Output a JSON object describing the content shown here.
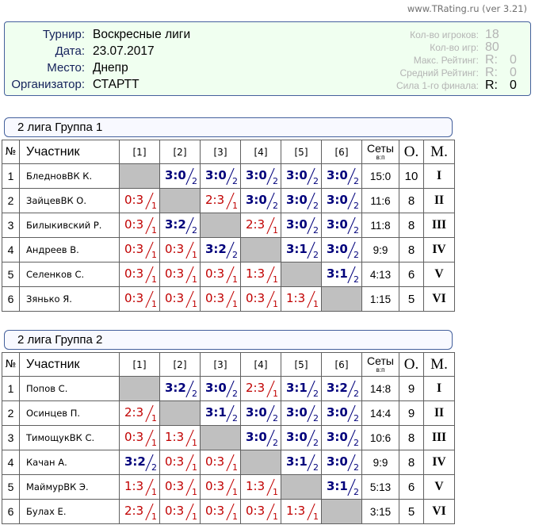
{
  "site": {
    "caption": "www.TRating.ru (ver 3.21)"
  },
  "colors": {
    "win": "#00007b",
    "loss": "#c00000",
    "self_cell": "#c0c0c0",
    "info_bg": "#f0fff0",
    "stat_text": "#b4b4b4",
    "stat_highlight": "#000000"
  },
  "info": {
    "fields": [
      {
        "label": "Турнир:",
        "value": "Воскресные лиги"
      },
      {
        "label": "Дата:",
        "value": "23.07.2017"
      },
      {
        "label": "Место:",
        "value": "Днепр"
      },
      {
        "label": "Организатор:",
        "value": "СТАРТТ"
      }
    ],
    "stats": [
      {
        "label": "Кол-во игроков:",
        "value": "18"
      },
      {
        "label": "Кол-во игр:",
        "value": "80"
      },
      {
        "label": "Макс. Рейтинг:",
        "prefix": "R:",
        "value": "0"
      },
      {
        "label": "Средний Рейтинг:",
        "prefix": "R:",
        "value": "0"
      },
      {
        "label": "Сила 1-го финала:",
        "prefix": "R:",
        "value": "0"
      }
    ]
  },
  "columns": {
    "num": "№",
    "name": "Участник",
    "opponents": [
      "[1]",
      "[2]",
      "[3]",
      "[4]",
      "[5]",
      "[6]"
    ],
    "sets": "Сеты",
    "sets_sub": "в:п",
    "points": "О.",
    "place": "М."
  },
  "groups": [
    {
      "title": "2 лига Группа 1",
      "rows": [
        {
          "num": "1",
          "name": "БледновВК К.",
          "cells": [
            null,
            {
              "score": "3:0",
              "pts": "2"
            },
            {
              "score": "3:0",
              "pts": "2"
            },
            {
              "score": "3:0",
              "pts": "2"
            },
            {
              "score": "3:0",
              "pts": "2"
            },
            {
              "score": "3:0",
              "pts": "2"
            }
          ],
          "sets": "15:0",
          "points": "10",
          "place": "I"
        },
        {
          "num": "2",
          "name": "ЗайцевВК О.",
          "cells": [
            {
              "score": "0:3",
              "pts": "1"
            },
            null,
            {
              "score": "2:3",
              "pts": "1"
            },
            {
              "score": "3:0",
              "pts": "2"
            },
            {
              "score": "3:0",
              "pts": "2"
            },
            {
              "score": "3:0",
              "pts": "2"
            }
          ],
          "sets": "11:6",
          "points": "8",
          "place": "II"
        },
        {
          "num": "3",
          "name": "Билыкивский Р.",
          "cells": [
            {
              "score": "0:3",
              "pts": "1"
            },
            {
              "score": "3:2",
              "pts": "2"
            },
            null,
            {
              "score": "2:3",
              "pts": "1"
            },
            {
              "score": "3:0",
              "pts": "2"
            },
            {
              "score": "3:0",
              "pts": "2"
            }
          ],
          "sets": "11:8",
          "points": "8",
          "place": "III"
        },
        {
          "num": "4",
          "name": "Андреев В.",
          "cells": [
            {
              "score": "0:3",
              "pts": "1"
            },
            {
              "score": "0:3",
              "pts": "1"
            },
            {
              "score": "3:2",
              "pts": "2"
            },
            null,
            {
              "score": "3:1",
              "pts": "2"
            },
            {
              "score": "3:0",
              "pts": "2"
            }
          ],
          "sets": "9:9",
          "points": "8",
          "place": "IV"
        },
        {
          "num": "5",
          "name": "Селенков С.",
          "cells": [
            {
              "score": "0:3",
              "pts": "1"
            },
            {
              "score": "0:3",
              "pts": "1"
            },
            {
              "score": "0:3",
              "pts": "1"
            },
            {
              "score": "1:3",
              "pts": "1"
            },
            null,
            {
              "score": "3:1",
              "pts": "2"
            }
          ],
          "sets": "4:13",
          "points": "6",
          "place": "V"
        },
        {
          "num": "6",
          "name": "Зянько Я.",
          "cells": [
            {
              "score": "0:3",
              "pts": "1"
            },
            {
              "score": "0:3",
              "pts": "1"
            },
            {
              "score": "0:3",
              "pts": "1"
            },
            {
              "score": "0:3",
              "pts": "1"
            },
            {
              "score": "1:3",
              "pts": "1"
            },
            null
          ],
          "sets": "1:15",
          "points": "5",
          "place": "VI"
        }
      ]
    },
    {
      "title": "2 лига Группа 2",
      "rows": [
        {
          "num": "1",
          "name": "Попов С.",
          "cells": [
            null,
            {
              "score": "3:2",
              "pts": "2"
            },
            {
              "score": "3:0",
              "pts": "2"
            },
            {
              "score": "2:3",
              "pts": "1"
            },
            {
              "score": "3:1",
              "pts": "2"
            },
            {
              "score": "3:2",
              "pts": "2"
            }
          ],
          "sets": "14:8",
          "points": "9",
          "place": "I"
        },
        {
          "num": "2",
          "name": "Осинцев П.",
          "cells": [
            {
              "score": "2:3",
              "pts": "1"
            },
            null,
            {
              "score": "3:1",
              "pts": "2"
            },
            {
              "score": "3:0",
              "pts": "2"
            },
            {
              "score": "3:0",
              "pts": "2"
            },
            {
              "score": "3:0",
              "pts": "2"
            }
          ],
          "sets": "14:4",
          "points": "9",
          "place": "II"
        },
        {
          "num": "3",
          "name": "ТимощукВК С.",
          "cells": [
            {
              "score": "0:3",
              "pts": "1"
            },
            {
              "score": "1:3",
              "pts": "1"
            },
            null,
            {
              "score": "3:0",
              "pts": "2"
            },
            {
              "score": "3:0",
              "pts": "2"
            },
            {
              "score": "3:0",
              "pts": "2"
            }
          ],
          "sets": "10:6",
          "points": "8",
          "place": "III"
        },
        {
          "num": "4",
          "name": "Качан А.",
          "cells": [
            {
              "score": "3:2",
              "pts": "2"
            },
            {
              "score": "0:3",
              "pts": "1"
            },
            {
              "score": "0:3",
              "pts": "1"
            },
            null,
            {
              "score": "3:1",
              "pts": "2"
            },
            {
              "score": "3:0",
              "pts": "2"
            }
          ],
          "sets": "9:9",
          "points": "8",
          "place": "IV"
        },
        {
          "num": "5",
          "name": "МаймурВК Э.",
          "cells": [
            {
              "score": "1:3",
              "pts": "1"
            },
            {
              "score": "0:3",
              "pts": "1"
            },
            {
              "score": "0:3",
              "pts": "1"
            },
            {
              "score": "1:3",
              "pts": "1"
            },
            null,
            {
              "score": "3:1",
              "pts": "2"
            }
          ],
          "sets": "5:13",
          "points": "6",
          "place": "V"
        },
        {
          "num": "6",
          "name": "Булах Е.",
          "cells": [
            {
              "score": "2:3",
              "pts": "1"
            },
            {
              "score": "0:3",
              "pts": "1"
            },
            {
              "score": "0:3",
              "pts": "1"
            },
            {
              "score": "0:3",
              "pts": "1"
            },
            {
              "score": "1:3",
              "pts": "1"
            },
            null
          ],
          "sets": "3:15",
          "points": "5",
          "place": "VI"
        }
      ]
    }
  ]
}
